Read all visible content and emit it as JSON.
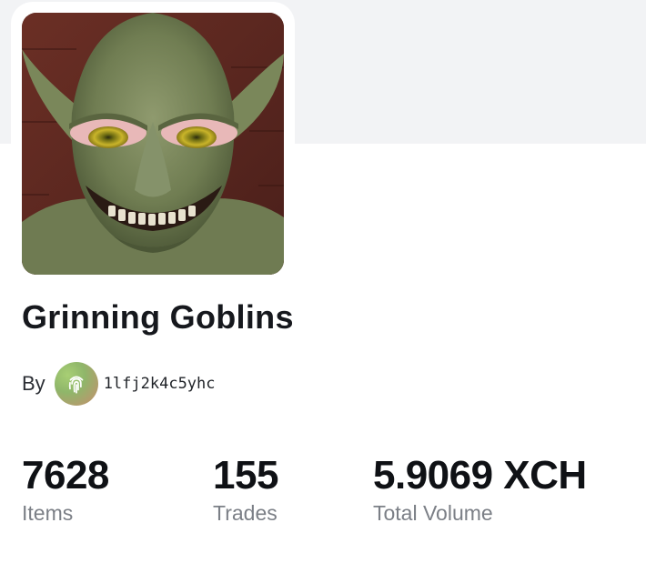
{
  "collection": {
    "title": "Grinning Goblins",
    "by_label": "By",
    "creator_name": "1lfj2k4c5yhc"
  },
  "stats": [
    {
      "value": "7628",
      "label": "Items"
    },
    {
      "value": "155",
      "label": "Trades"
    },
    {
      "value": "5.9069 XCH",
      "label": "Total Volume"
    }
  ],
  "colors": {
    "banner": "#f2f3f5",
    "title": "#16181d",
    "stat_label": "#7b7f86"
  },
  "icons": {
    "creator_avatar": "fingerprint-icon"
  }
}
